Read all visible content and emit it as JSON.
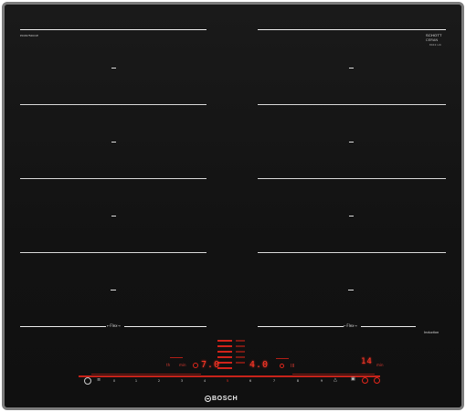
{
  "appliance": {
    "brand": "BOSCH",
    "model_label": "PXX675DC1E",
    "glass_brand": [
      "SCHOTT",
      "CERAN",
      "8043 HC"
    ],
    "technology_label": "Induction",
    "flex_label": "←Flex→"
  },
  "zones": {
    "left": [
      {
        "mark": "power-level-off"
      },
      {
        "mark": "power-level-off"
      },
      {
        "mark": "power-level-off"
      },
      {
        "mark": "power-level-off"
      }
    ],
    "right": [
      {
        "mark": "power-level-off"
      },
      {
        "mark": "power-level-off"
      },
      {
        "mark": "power-level-off"
      },
      {
        "mark": "power-level-off"
      }
    ]
  },
  "control_panel": {
    "power_display": "7.0",
    "second_display": "4.0",
    "timer_display": "14",
    "timer_unit": "min",
    "small_labels": [
      "th",
      "min",
      "○",
      "○",
      "III"
    ],
    "scale": [
      "0",
      "1",
      "2",
      "3",
      "4",
      "5",
      "6",
      "7",
      "8",
      "9"
    ],
    "active_level": "5",
    "colors": {
      "display": "#ff3a2a",
      "slider": "#c7231a",
      "glass": "#141414",
      "frame": "#7d7d7d"
    },
    "icons": [
      "power-icon",
      "child-lock-icon",
      "powerboost-icon",
      "timer-icon",
      "settings-icon"
    ]
  }
}
